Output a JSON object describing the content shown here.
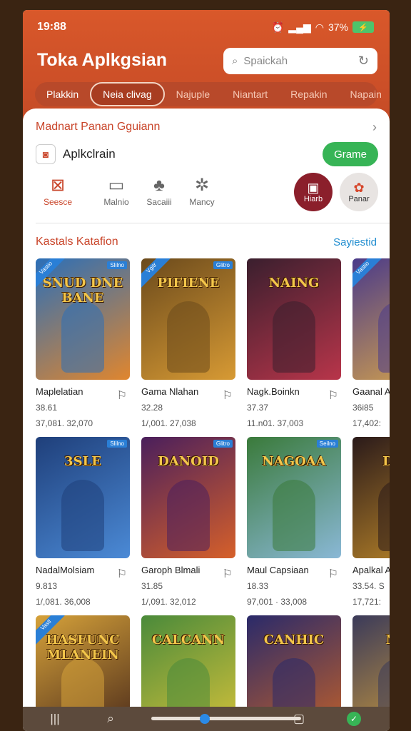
{
  "status": {
    "time": "19:88",
    "battery_text": "37%"
  },
  "header": {
    "title": "Toka Aplkgsian",
    "search_placeholder": "Spaickah"
  },
  "tabs": [
    "Plakkin",
    "Neia clivag",
    "Najuple",
    "Niantart",
    "Repakin",
    "Napain"
  ],
  "featured": {
    "title": "Madnart Panan Gguiann",
    "app_name": "Aplkclrain",
    "button": "Grame"
  },
  "categories": [
    "Seesce",
    "Malnio",
    "Sacaiii",
    "Mancy"
  ],
  "round_buttons": [
    "Hiarb",
    "Panar"
  ],
  "section": {
    "title": "Kastals Katafion",
    "link": "Sayiestid"
  },
  "games": [
    {
      "name": "Maplelatian",
      "rating": "38.61",
      "meta": "37,081. 32,070",
      "art": "SNUD DNE BANE",
      "badge": "Slilno",
      "corner": "Vastio",
      "c1": "#2b6fb8",
      "c2": "#e0862e"
    },
    {
      "name": "Gama Nlahan",
      "rating": "32.28",
      "meta": "1/,001. 27,038",
      "art": "PIFIENE",
      "badge": "Glitro",
      "corner": "Vgitr",
      "c1": "#6b4a1c",
      "c2": "#d79a34"
    },
    {
      "name": "Nagk.Boinkn",
      "rating": "37.37",
      "meta": "11.n01. 37,003",
      "art": "NAING",
      "badge": "",
      "corner": "",
      "c1": "#3a1f2e",
      "c2": "#b8354a"
    },
    {
      "name": "Gaanal A",
      "rating": "36i85",
      "meta": "17,402:",
      "art": "",
      "badge": "",
      "corner": "Vastio",
      "c1": "#4a3a8a",
      "c2": "#d9a64a"
    },
    {
      "name": "NadalMolsiam",
      "rating": "9.813",
      "meta": "1/,081. 36,008",
      "art": "3SLE",
      "badge": "Slilno",
      "corner": "",
      "c1": "#1f3f7a",
      "c2": "#4b8ad6"
    },
    {
      "name": "Garoph Blmali",
      "rating": "31.85",
      "meta": "1/,091. 32,012",
      "art": "DANOID",
      "badge": "Glitro",
      "corner": "",
      "c1": "#4a1f5c",
      "c2": "#d6602a"
    },
    {
      "name": "Maul Capsiaan",
      "rating": "18.33",
      "meta": "97,001 · 33,008",
      "art": "NAGOAA",
      "badge": "Seilno",
      "corner": "",
      "c1": "#3a7a3a",
      "c2": "#8ab8d6"
    },
    {
      "name": "Apalkal A",
      "rating": "33.54. S",
      "meta": "17,721:",
      "art": "DUN",
      "badge": "",
      "corner": "",
      "c1": "#2a1a1a",
      "c2": "#c08a2a"
    },
    {
      "name": "",
      "rating": "",
      "meta": "",
      "art": "HASFUNC MLANEIN",
      "badge": "",
      "corner": "Vastl",
      "c1": "#d6a23a",
      "c2": "#4a2a1a"
    },
    {
      "name": "",
      "rating": "",
      "meta": "",
      "art": "CALCANN",
      "badge": "",
      "corner": "",
      "c1": "#4a8a3a",
      "c2": "#d6c23a"
    },
    {
      "name": "",
      "rating": "",
      "meta": "",
      "art": "CANHIC",
      "badge": "",
      "corner": "",
      "c1": "#2a2a6a",
      "c2": "#c0602a"
    },
    {
      "name": "",
      "rating": "",
      "meta": "",
      "art": "NAI",
      "badge": "",
      "corner": "",
      "c1": "#3a3a5a",
      "c2": "#d6a23a"
    }
  ],
  "colors": {
    "accent": "#cc4f28",
    "link": "#1e8ccf",
    "green": "#37b456"
  }
}
